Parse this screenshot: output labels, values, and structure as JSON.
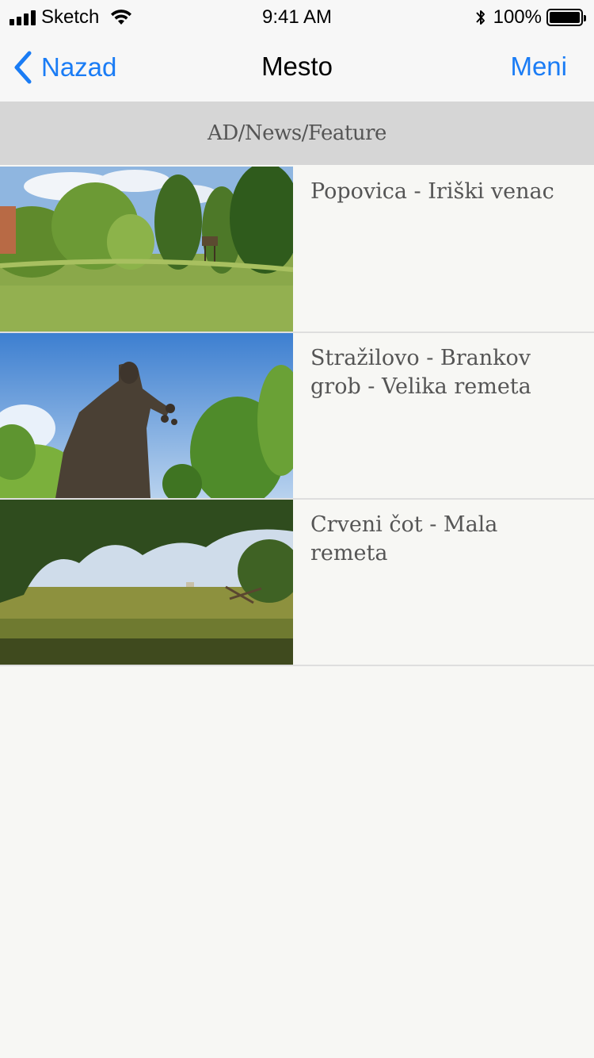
{
  "status_bar": {
    "carrier": "Sketch",
    "time": "9:41 AM",
    "battery": "100%"
  },
  "nav": {
    "back_label": "Nazad",
    "title": "Mesto",
    "menu_label": "Meni"
  },
  "section": {
    "header": "AD/News/Feature"
  },
  "items": [
    {
      "title": "Popovica - Iriški venac",
      "image": "forest-meadow-photo"
    },
    {
      "title": "Stražilovo - Brankov grob - Velika remeta",
      "image": "statue-photo"
    },
    {
      "title": "Crveni čot - Mala remeta",
      "image": "field-under-trees-photo"
    }
  ],
  "colors": {
    "accent": "#1a7cf5",
    "background": "#f7f7f4",
    "section_bg": "#d6d6d6",
    "text": "#555555"
  }
}
